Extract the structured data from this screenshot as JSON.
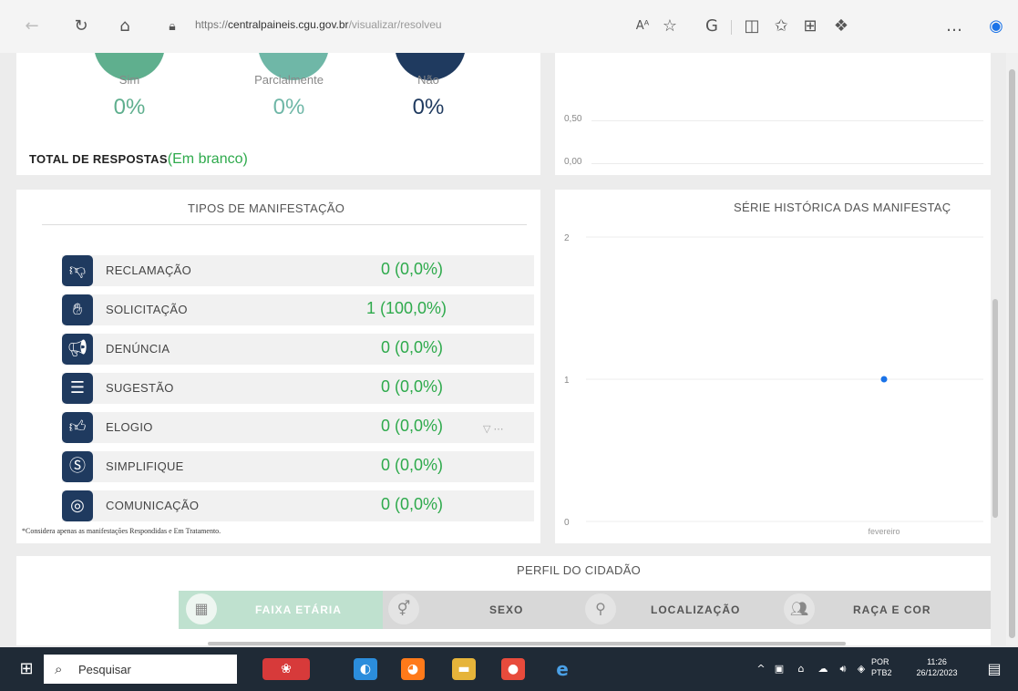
{
  "browser": {
    "url_scheme": "https://",
    "url_host": "centralpaineis.cgu.gov.br",
    "url_path": "/visualizar/resolveu",
    "icons": [
      "back-icon",
      "refresh-icon",
      "home-icon",
      "lock-icon",
      "read-aloud-icon",
      "favorite-icon",
      "copilot-icon",
      "split-screen-icon",
      "favorites-bar-icon",
      "collections-icon",
      "extensions-icon",
      "more-icon",
      "edge-sidebar-icon"
    ]
  },
  "resolution": {
    "items": [
      {
        "label": "Sim",
        "value": "0%",
        "color": "#5faf8e"
      },
      {
        "label": "Parcialmente",
        "value": "0%",
        "color": "#6fb7a7"
      },
      {
        "label": "Não",
        "value": "0%",
        "color": "#1f3a5f"
      }
    ],
    "total_label": "TOTAL DE RESPOSTAS",
    "total_value": "(Em branco)"
  },
  "top_chart": {
    "ticks": [
      "0,50",
      "0,00"
    ]
  },
  "manifestacoes": {
    "title": "TIPOS DE MANIFESTAÇÃO",
    "rows": [
      {
        "label": "RECLAMAÇÃO",
        "value": "0 (0,0%)",
        "icon": "thumbs-down-icon"
      },
      {
        "label": "SOLICITAÇÃO",
        "value": "1 (100,0%)",
        "icon": "request-icon"
      },
      {
        "label": "DENÚNCIA",
        "value": "0 (0,0%)",
        "icon": "megaphone-icon"
      },
      {
        "label": "SUGESTÃO",
        "value": "0 (0,0%)",
        "icon": "chat-icon"
      },
      {
        "label": "ELOGIO",
        "value": "0 (0,0%)",
        "icon": "thumbs-up-icon"
      },
      {
        "label": "SIMPLIFIQUE",
        "value": "0 (0,0%)",
        "icon": "simplifique-icon"
      },
      {
        "label": "COMUNICAÇÃO",
        "value": "0 (0,0%)",
        "icon": "communication-icon"
      }
    ],
    "footnote": "*Considera apenas as manifestações Respondidas e Em Tratamento."
  },
  "chart_data": {
    "type": "scatter",
    "title": "SÉRIE HISTÓRICA DAS MANIFESTAÇ",
    "categories": [
      "fevereiro"
    ],
    "values": [
      1
    ],
    "ylim": [
      0,
      2
    ],
    "yticks": [
      "2",
      "1",
      "0"
    ],
    "grid": true,
    "color": "#1a73e8"
  },
  "perfil": {
    "title": "PERFIL DO CIDADÃO",
    "tabs": [
      {
        "label": "FAIXA ETÁRIA",
        "icon": "calendar-icon",
        "active": true
      },
      {
        "label": "SEXO",
        "icon": "gender-icon",
        "active": false
      },
      {
        "label": "LOCALIZAÇÃO",
        "icon": "location-pin-icon",
        "active": false
      },
      {
        "label": "RAÇA E COR",
        "icon": "people-icon",
        "active": false
      }
    ]
  },
  "taskbar": {
    "search_placeholder": "Pesquisar",
    "lang_top": "POR",
    "lang_bottom": "PTB2",
    "time": "11:26",
    "date": "26/12/2023"
  }
}
